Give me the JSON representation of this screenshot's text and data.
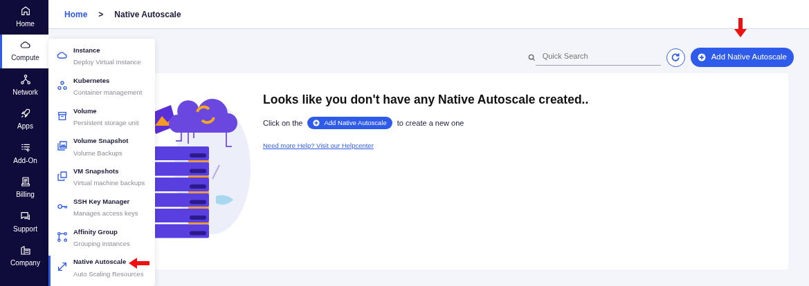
{
  "sidebar": {
    "items": [
      {
        "label": "Home",
        "selected": false
      },
      {
        "label": "Compute",
        "selected": true
      },
      {
        "label": "Network",
        "selected": false
      },
      {
        "label": "Apps",
        "selected": false
      },
      {
        "label": "Add-On",
        "selected": false
      },
      {
        "label": "Billing",
        "selected": false
      },
      {
        "label": "Support",
        "selected": false
      },
      {
        "label": "Company",
        "selected": false
      }
    ]
  },
  "breadcrumb": {
    "items": [
      "Home",
      "Native Autoscale"
    ],
    "separator": ">"
  },
  "compute_menu": {
    "items": [
      {
        "title": "Instance",
        "subtitle": "Deploy Virtual Instance",
        "selected": false
      },
      {
        "title": "Kubernetes",
        "subtitle": "Container management",
        "selected": false
      },
      {
        "title": "Volume",
        "subtitle": "Persistent storage unit",
        "selected": false
      },
      {
        "title": "Volume Snapshot",
        "subtitle": "Volume Backups",
        "selected": false
      },
      {
        "title": "VM Snapshots",
        "subtitle": "Virtual machine backups",
        "selected": false
      },
      {
        "title": "SSH Key Manager",
        "subtitle": "Manages access keys",
        "selected": false
      },
      {
        "title": "Affinity Group",
        "subtitle": "Grouping instances",
        "selected": false
      },
      {
        "title": "Native Autoscale",
        "subtitle": "Auto Scaling Resources",
        "selected": true
      }
    ]
  },
  "toolbar": {
    "search": {
      "placeholder": "Quick Search"
    },
    "add_button": "Add Native Autoscale"
  },
  "empty_state": {
    "heading": "Looks like you don't have any Native Autoscale created..",
    "text_before": "Click on the",
    "button": "Add Native Autoscale",
    "text_after": "to create a new one",
    "help_link": "Need more Help? Visit our Helpcenter"
  }
}
